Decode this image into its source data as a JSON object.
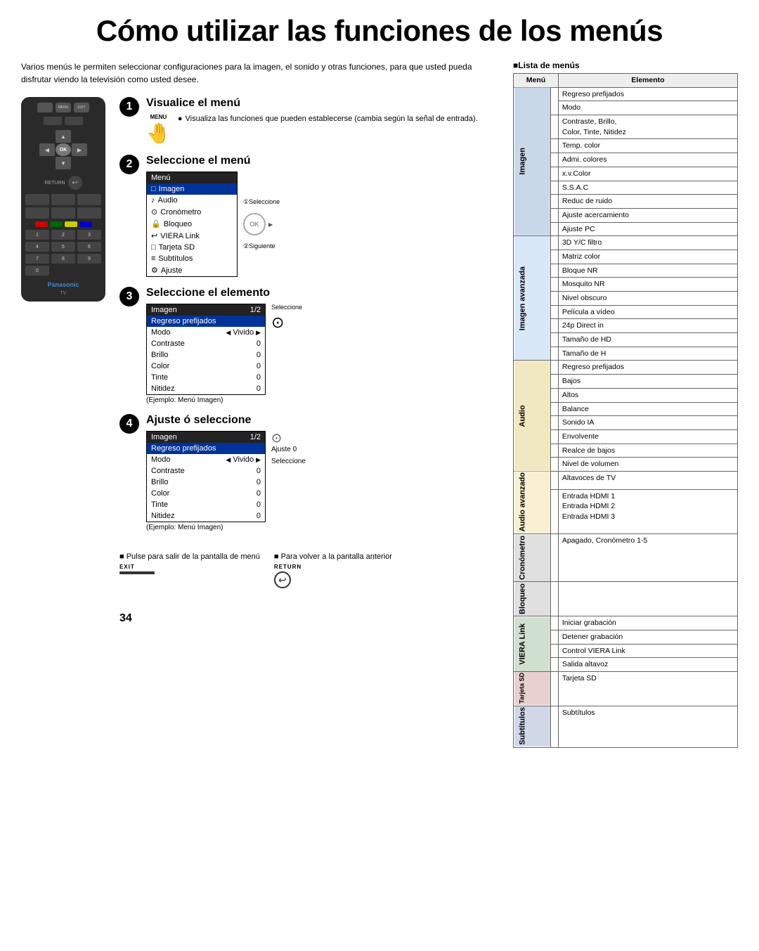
{
  "page": {
    "title": "Cómo utilizar las funciones de los menús",
    "page_number": "34",
    "intro": "Varios menús le permiten seleccionar configuraciones para la imagen, el sonido y otras funciones, para que usted pueda disfrutar viendo la televisión como usted desee."
  },
  "steps": [
    {
      "number": "1",
      "title": "Visualice el menú",
      "icon_label": "MENU",
      "desc": "Visualiza las funciones que pueden establecerse (cambia según la señal de entrada)."
    },
    {
      "number": "2",
      "title": "Seleccione el menú",
      "indicator1": "①Seleccione",
      "indicator2": "②Siguiente"
    },
    {
      "number": "3",
      "title": "Seleccione el elemento",
      "indicator": "Seleccione",
      "example": "(Ejemplo: Menú Imagen)"
    },
    {
      "number": "4",
      "title": "Ajuste ó seleccione",
      "ajuste_label": "Ajuste 0",
      "seleccione_label": "Seleccione",
      "example": "(Ejemplo: Menú Imagen)"
    }
  ],
  "menu_step2": {
    "title": "Menú",
    "items": [
      {
        "icon": "□",
        "label": "Imagen",
        "selected": true
      },
      {
        "icon": "♪",
        "label": "Audio"
      },
      {
        "icon": "⊙",
        "label": "Cronómetro"
      },
      {
        "icon": "🔒",
        "label": "Bloqueo"
      },
      {
        "icon": "↩",
        "label": "VIERA Link"
      },
      {
        "icon": "□",
        "label": "Tarjeta SD"
      },
      {
        "icon": "≡",
        "label": "Subtítulos"
      },
      {
        "icon": "⚙",
        "label": "Ajuste"
      }
    ]
  },
  "menu_step3": {
    "title": "Imagen",
    "page": "1/2",
    "items": [
      {
        "label": "Regreso prefijados",
        "selected": true
      },
      {
        "label": "Modo",
        "value": "Vivido",
        "has_arrows": true
      },
      {
        "label": "Contraste",
        "value": "0"
      },
      {
        "label": "Brillo",
        "value": "0"
      },
      {
        "label": "Color",
        "value": "0"
      },
      {
        "label": "Tinte",
        "value": "0"
      },
      {
        "label": "Nitidez",
        "value": "0"
      }
    ]
  },
  "menu_step4": {
    "title": "Imagen",
    "page": "1/2",
    "items": [
      {
        "label": "Regreso prefijados",
        "selected": true
      },
      {
        "label": "Modo",
        "value": "Vivido",
        "has_arrows": true
      },
      {
        "label": "Contraste",
        "value": "0"
      },
      {
        "label": "Brillo",
        "value": "0"
      },
      {
        "label": "Color",
        "value": "0"
      },
      {
        "label": "Tinte",
        "value": "0"
      },
      {
        "label": "Nitidez",
        "value": "0"
      }
    ]
  },
  "bottom_notes": {
    "pulse_title": "■ Pulse para salir de la pantalla de menú",
    "exit_label": "EXIT",
    "return_title": "■ Para volver a la pantalla anterior",
    "return_label": "RETURN"
  },
  "list_title": "■Lista de menús",
  "table": {
    "headers": [
      "Menú",
      "Elemento"
    ],
    "categories": [
      {
        "name": "Imagen",
        "cat_class": "cat-imagen",
        "items": [
          "Regreso prefijados",
          "Modo",
          "Contraste, Brillo,\nColor, Tinte, Nitidez",
          "Temp. color",
          "Admi. colores",
          "x.v.Color",
          "S.S.A.C",
          "Reduc de ruido",
          "Ajuste acercamiento",
          "Ajuste PC"
        ]
      },
      {
        "name": "Imagen avanzada",
        "cat_class": "cat-imagen-av",
        "items": [
          "3D Y/C filtro",
          "Matriz color",
          "Bloque NR",
          "Mosquito NR",
          "Nivel obscuro",
          "Película a vídeo",
          "24p Direct in",
          "Tamaño de HD",
          "Tamaño de H"
        ]
      },
      {
        "name": "Audio",
        "cat_class": "cat-audio",
        "items": [
          "Regreso prefijados",
          "Bajos",
          "Altos",
          "Balance",
          "Sonido IA",
          "Envolvente",
          "Realce de bajos",
          "Nivel de volumen"
        ]
      },
      {
        "name": "Audio avanzado",
        "cat_class": "cat-audio-av",
        "items": [
          "Altavoces de TV",
          "Entrada HDMI 1\nEntrada HDMI 2\nEntrada HDMI 3"
        ]
      },
      {
        "name": "Cronómetro",
        "cat_class": "cat-cronometro",
        "items": [
          "Apagado, Cronómetro 1-5"
        ]
      },
      {
        "name": "Bloqueo",
        "cat_class": "cat-bloqueo",
        "items": []
      },
      {
        "name": "VIERA Link",
        "cat_class": "cat-viera",
        "items": [
          "Iniciar grabación",
          "Detener grabación",
          "Control VIERA Link",
          "Salida altavoz"
        ]
      },
      {
        "name": "Tarjeta SD",
        "cat_class": "cat-tarjeta",
        "items": [
          "Tarjeta SD"
        ]
      },
      {
        "name": "Subtítulos",
        "cat_class": "cat-subtitulos",
        "items": [
          "Subtítulos"
        ]
      }
    ]
  }
}
